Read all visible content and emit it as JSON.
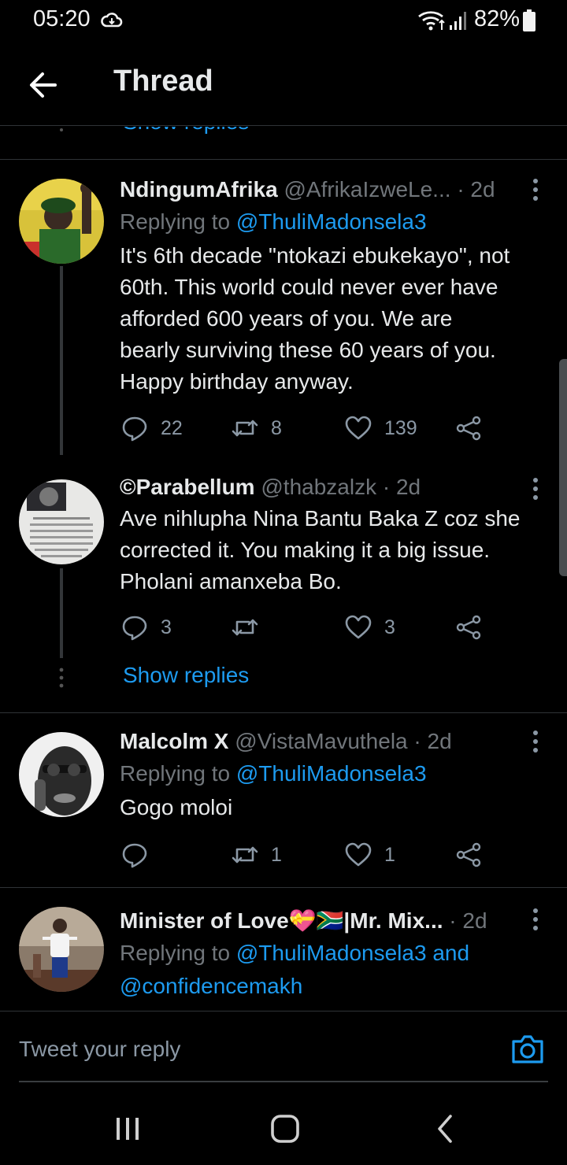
{
  "status_bar": {
    "time": "05:20",
    "battery": "82%"
  },
  "header": {
    "title": "Thread"
  },
  "top_show_replies": "Show replies",
  "tweets": [
    {
      "name": "NdingumAfrika",
      "handle": "@AfrikaIzweLe...",
      "time": "· 2d",
      "replying_prefix": "Replying to ",
      "replying_to": "@ThuliMadonsela3",
      "text_lines": [
        "It's 6th decade \"ntokazi ebukekayo\", not",
        "60th. This world could never ever have",
        "afforded 600 years of you. We are",
        "bearly surviving these 60 years of you.",
        "Happy birthday anyway."
      ],
      "replies": "22",
      "retweets": "8",
      "likes": "139"
    },
    {
      "name": "©Parabellum",
      "handle": "@thabzalzk",
      "time": "· 2d",
      "text_lines": [
        "Ave nihlupha Nina Bantu Baka Z coz she",
        "corrected it. You making it a big issue.",
        "Pholani amanxeba Bo."
      ],
      "replies": "3",
      "retweets": "",
      "likes": "3",
      "show_replies": "Show replies"
    },
    {
      "name": "Malcolm X",
      "handle": "@VistaMavuthela",
      "time": "· 2d",
      "replying_prefix": "Replying to ",
      "replying_to": "@ThuliMadonsela3",
      "text_lines": [
        "Gogo moloi"
      ],
      "replies": "",
      "retweets": "1",
      "likes": "1"
    },
    {
      "name": "Minister of Love💝🇿🇦|Mr. Mix...",
      "handle": "",
      "time": "· 2d",
      "replying_prefix": "Replying to ",
      "replying_to": "@ThuliMadonsela3 and",
      "replying_to_2": "@confidencemakh"
    }
  ],
  "composer": {
    "placeholder": "Tweet your reply"
  },
  "colors": {
    "background": "#000000",
    "link": "#1d9bf0",
    "muted": "#71767b",
    "text": "#e7e9ea"
  }
}
